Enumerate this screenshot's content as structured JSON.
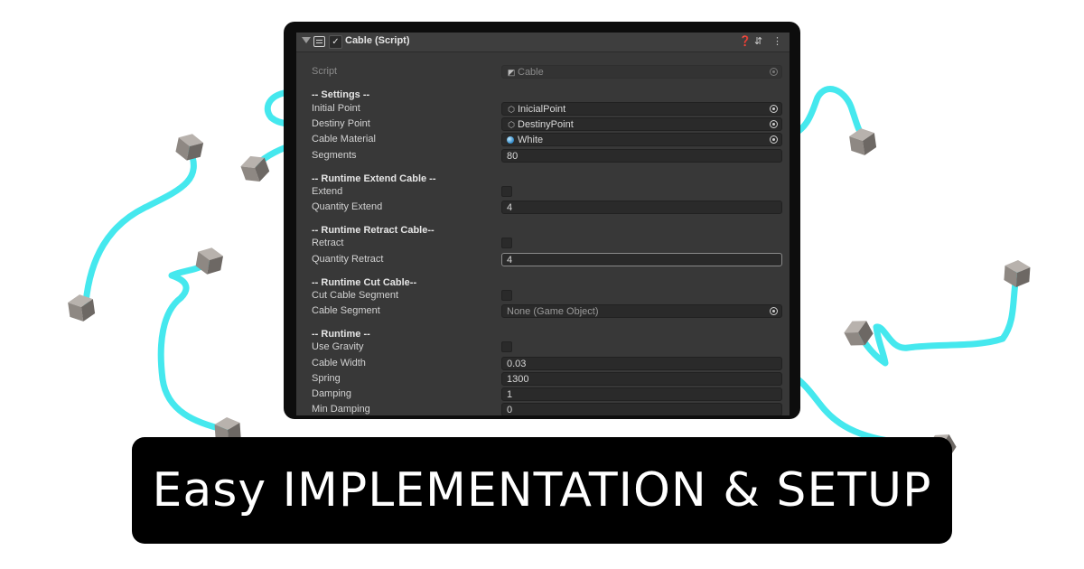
{
  "component": {
    "title": "Cable (Script)",
    "enabled_mark": "✓",
    "icons": [
      "help-icon",
      "preset-icon",
      "kebab-menu-icon"
    ]
  },
  "rows": {
    "script": {
      "label": "Script",
      "value": "Cable"
    },
    "settings_header": "-- Settings --",
    "initial_point": {
      "label": "Initial Point",
      "value": "InicialPoint"
    },
    "destiny_point": {
      "label": "Destiny Point",
      "value": "DestinyPoint"
    },
    "cable_material": {
      "label": "Cable Material",
      "value": "White"
    },
    "segments": {
      "label": "Segments",
      "value": "80"
    },
    "extend_header": "-- Runtime Extend Cable --",
    "extend": {
      "label": "Extend"
    },
    "quantity_extend": {
      "label": "Quantity Extend",
      "value": "4"
    },
    "retract_header": "-- Runtime Retract Cable--",
    "retract": {
      "label": "Retract"
    },
    "quantity_retract": {
      "label": "Quantity Retract",
      "value": "4"
    },
    "cut_header": "-- Runtime Cut Cable--",
    "cut_cable_segment": {
      "label": "Cut Cable Segment"
    },
    "cable_segment": {
      "label": "Cable Segment",
      "value": "None (Game Object)"
    },
    "runtime_header": "-- Runtime --",
    "use_gravity": {
      "label": "Use Gravity"
    },
    "cable_width": {
      "label": "Cable Width",
      "value": "0.03"
    },
    "spring": {
      "label": "Spring",
      "value": "1300"
    },
    "damping": {
      "label": "Damping",
      "value": "1"
    },
    "min_damping": {
      "label": "Min Damping",
      "value": "0"
    }
  },
  "banner": {
    "text": "Easy IMPLEMENTATION & SETUP"
  },
  "colors": {
    "cable": "#45e8ee",
    "panel": "#383838",
    "frame": "#0d0d0d",
    "banner": "#000000"
  }
}
